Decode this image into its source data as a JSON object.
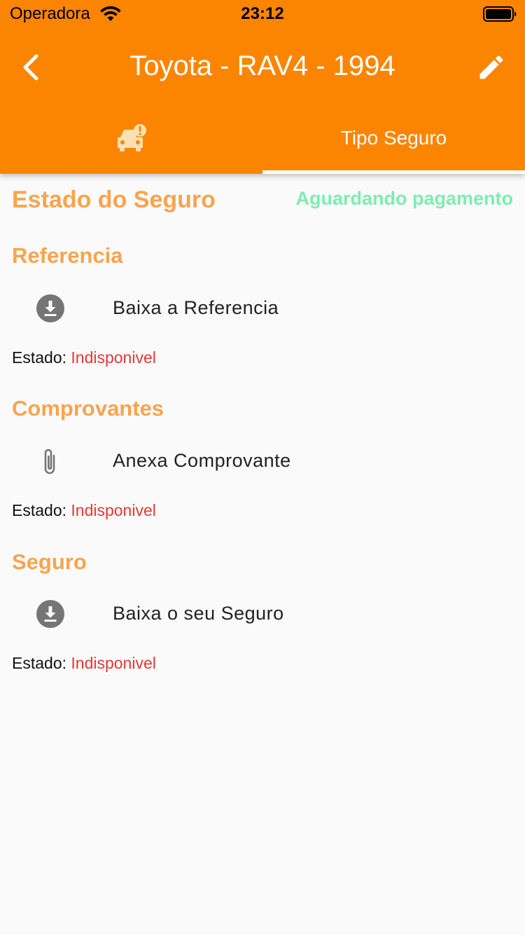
{
  "status_bar": {
    "carrier": "Operadora",
    "time": "23:12",
    "wifi_icon": "wifi-icon",
    "battery_icon": "battery-icon"
  },
  "app_bar": {
    "title": "Toyota - RAV4 - 1994",
    "back_icon": "chevron-left-icon",
    "edit_icon": "pencil-icon",
    "background_color": "#fb8500"
  },
  "tabs": [
    {
      "icon": "car-alert-icon",
      "label": "",
      "selected": false
    },
    {
      "label": "Tipo Seguro",
      "selected": true
    }
  ],
  "insurance": {
    "status_title": "Estado do Seguro",
    "status_value": "Aguardando pagamento",
    "status_color": "#7eecb3"
  },
  "sections": [
    {
      "title": "Referencia",
      "action_label": "Baixa a Referencia",
      "action_icon": "download-icon",
      "status_label": "Estado:",
      "status_value": "Indisponivel"
    },
    {
      "title": "Comprovantes",
      "action_label": "Anexa Comprovante",
      "action_icon": "paperclip-icon",
      "status_label": "Estado:",
      "status_value": "Indisponivel"
    },
    {
      "title": "Seguro",
      "action_label": "Baixa o seu Seguro",
      "action_icon": "download-icon",
      "status_label": "Estado:",
      "status_value": "Indisponivel"
    }
  ],
  "colors": {
    "accent": "#f9a44e",
    "unavailable": "#e53935",
    "icon_gray": "#757575"
  }
}
